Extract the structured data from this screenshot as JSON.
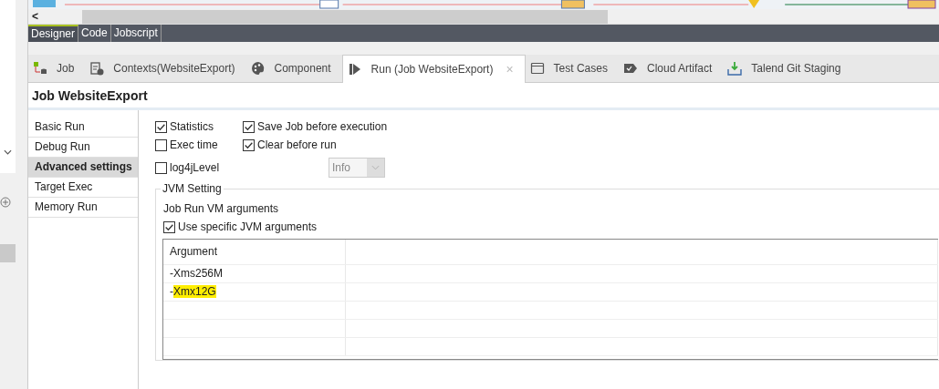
{
  "scroll_arrow": "<",
  "editor_tabs": [
    {
      "label": "Designer",
      "selected": true
    },
    {
      "label": "Code",
      "selected": false
    },
    {
      "label": "Jobscript",
      "selected": false
    }
  ],
  "view_tabs": [
    {
      "label": "Job",
      "selected": false
    },
    {
      "label": "Contexts(WebsiteExport)",
      "selected": false
    },
    {
      "label": "Component",
      "selected": false
    },
    {
      "label": "Run (Job WebsiteExport)",
      "selected": true,
      "close": "×"
    },
    {
      "label": "Test Cases",
      "selected": false
    },
    {
      "label": "Cloud Artifact",
      "selected": false
    },
    {
      "label": "Talend Git Staging",
      "selected": false
    }
  ],
  "panel_title": "Job WebsiteExport",
  "sidebar": {
    "items": [
      {
        "label": "Basic Run",
        "selected": false
      },
      {
        "label": "Debug Run",
        "selected": false
      },
      {
        "label": "Advanced settings",
        "selected": true
      },
      {
        "label": "Target Exec",
        "selected": false
      },
      {
        "label": "Memory Run",
        "selected": false
      }
    ]
  },
  "options": [
    {
      "label": "Statistics",
      "checked": true
    },
    {
      "label": "Save Job before execution",
      "checked": true
    },
    {
      "label": "Exec time",
      "checked": false
    },
    {
      "label": "Clear before run",
      "checked": true
    }
  ],
  "log4j": {
    "label": "log4jLevel",
    "checked": false,
    "level_value": "Info",
    "disabled": true
  },
  "jvm": {
    "legend": "JVM Setting",
    "subtitle": "Job Run VM arguments",
    "use_specific": {
      "label": "Use specific JVM arguments",
      "checked": true
    },
    "table": {
      "columns": [
        "Argument"
      ],
      "rows": [
        [
          {
            "text": "-Xms256M",
            "highlighted": false
          }
        ],
        [
          {
            "text": "-",
            "highlighted": false
          },
          {
            "text": "Xmx12G",
            "highlighted": true
          }
        ]
      ]
    }
  }
}
